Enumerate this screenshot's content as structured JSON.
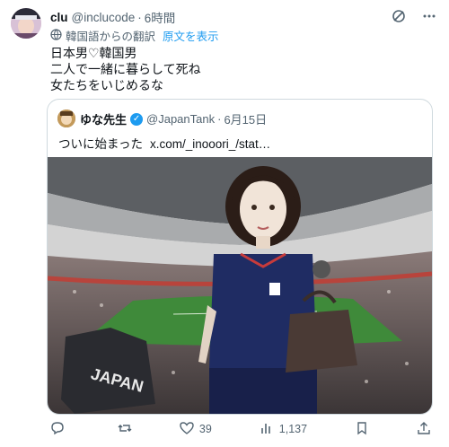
{
  "tweet": {
    "author_name": "clu",
    "author_handle": "@inclucode",
    "separator": "·",
    "time": "6時間",
    "translated_from": "韓国語からの翻訳",
    "show_original": "原文を表示",
    "lines": [
      "日本男♡韓国男",
      "二人で一緒に暮らして死ね",
      "女たちをいじめるな"
    ]
  },
  "quote": {
    "author_name": "ゆな先生",
    "author_handle": "@JapanTank",
    "separator": "·",
    "date": "6月15日",
    "text": "ついに始まった",
    "link": "x.com/_inooori_/stat…",
    "jersey_text": "JAPAN"
  },
  "actions": {
    "replies": "",
    "likes": "39",
    "views": "1,137"
  },
  "colors": {
    "accent": "#1d9bf0",
    "muted": "#536471",
    "border": "#cfd9de"
  },
  "icons": [
    "grok-icon",
    "more-icon",
    "translate-icon",
    "verified-icon",
    "reply-icon",
    "retweet-icon",
    "like-icon",
    "views-icon",
    "bookmark-icon",
    "share-icon"
  ]
}
